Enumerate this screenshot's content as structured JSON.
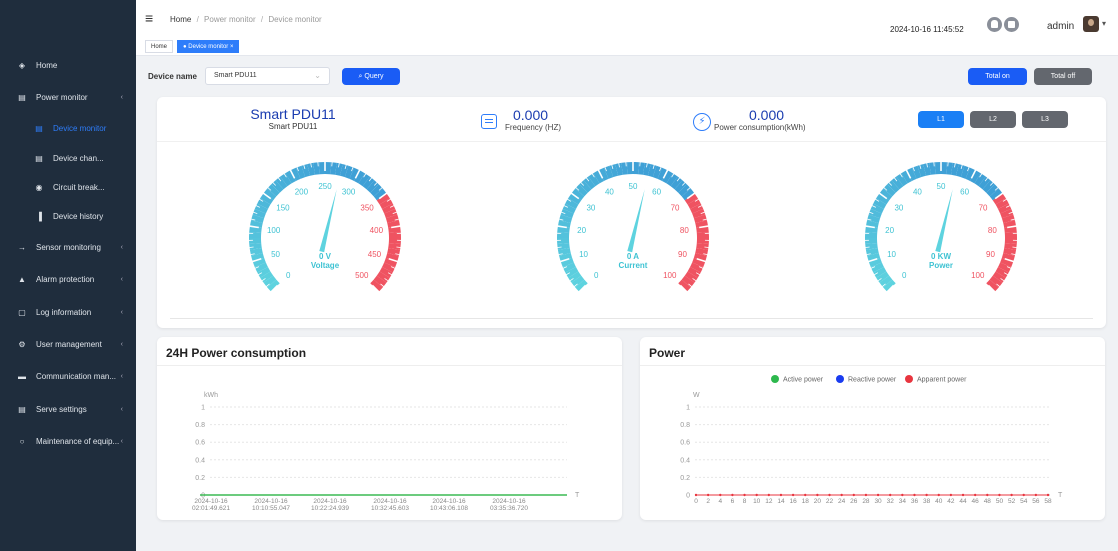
{
  "sidebar": {
    "items": [
      {
        "label": "Home",
        "icon": "dashboard-icon",
        "glyph": "◈",
        "sub": false,
        "active": false,
        "arrow": false
      },
      {
        "label": "Power monitor",
        "icon": "monitor-icon",
        "glyph": "▤",
        "sub": false,
        "active": false,
        "arrow": true
      },
      {
        "label": "Device monitor",
        "icon": "device-monitor-icon",
        "glyph": "▤",
        "sub": true,
        "active": true,
        "arrow": false
      },
      {
        "label": "Device chan...",
        "icon": "device-channel-icon",
        "glyph": "▤",
        "sub": true,
        "active": false,
        "arrow": false
      },
      {
        "label": "Circuit break...",
        "icon": "circuit-breaker-icon",
        "glyph": "◉",
        "sub": true,
        "active": false,
        "arrow": false
      },
      {
        "label": "Device history",
        "icon": "bar-chart-icon",
        "glyph": "▐",
        "sub": true,
        "active": false,
        "arrow": false
      },
      {
        "label": "Sensor monitoring",
        "icon": "sensor-icon",
        "glyph": "→",
        "sub": false,
        "active": false,
        "arrow": true
      },
      {
        "label": "Alarm protection",
        "icon": "alarm-icon",
        "glyph": "▲",
        "sub": false,
        "active": false,
        "arrow": true
      },
      {
        "label": "Log information",
        "icon": "log-icon",
        "glyph": "▢",
        "sub": false,
        "active": false,
        "arrow": true
      },
      {
        "label": "User management",
        "icon": "user-gear-icon",
        "glyph": "⚙",
        "sub": false,
        "active": false,
        "arrow": true
      },
      {
        "label": "Communication man...",
        "icon": "communication-icon",
        "glyph": "▬",
        "sub": false,
        "active": false,
        "arrow": true
      },
      {
        "label": "Serve settings",
        "icon": "server-settings-icon",
        "glyph": "▤",
        "sub": false,
        "active": false,
        "arrow": true
      },
      {
        "label": "Maintenance of equip...",
        "icon": "maintenance-icon",
        "glyph": "○",
        "sub": false,
        "active": false,
        "arrow": true
      }
    ],
    "arrow_glyph": "‹"
  },
  "header": {
    "menu_glyph": "≡",
    "breadcrumb": {
      "home": "Home",
      "sep": "/",
      "section": "Power monitor",
      "page": "Device monitor"
    },
    "datetime": "2024-10-16 11:45:52",
    "user": "admin",
    "caret": "▾"
  },
  "tags": {
    "home": "Home",
    "active": "● Device monitor ×"
  },
  "toolbar": {
    "device_label": "Device name",
    "device_value": "Smart PDU11",
    "select_arrow": "⌵",
    "query_label": "⌕ Query",
    "total_on": "Total on",
    "total_off": "Total off"
  },
  "summary": {
    "device_title": "Smart PDU11",
    "device_subtitle": "Smart PDU11",
    "frequency_value": "0.000",
    "frequency_label": "Frequency (HZ)",
    "power_value": "0.000",
    "power_label": "Power consumption(kWh)",
    "power_glyph": "⚡",
    "phases": [
      "L1",
      "L2",
      "L3"
    ],
    "active_phase": "L1"
  },
  "gauges": [
    {
      "value": 0,
      "min": 0,
      "max": 500,
      "ticks": [
        "0",
        "50",
        "100",
        "150",
        "200",
        "250",
        "300",
        "350",
        "400",
        "450",
        "500"
      ],
      "readout": "0 V",
      "name": "Voltage"
    },
    {
      "value": 0,
      "min": 0,
      "max": 100,
      "ticks": [
        "0",
        "10",
        "20",
        "30",
        "40",
        "50",
        "60",
        "70",
        "80",
        "90",
        "100"
      ],
      "readout": "0 A",
      "name": "Current"
    },
    {
      "value": 0,
      "min": 0,
      "max": 100,
      "ticks": [
        "0",
        "10",
        "20",
        "30",
        "40",
        "50",
        "60",
        "70",
        "80",
        "90",
        "100"
      ],
      "readout": "0 KW",
      "name": "Power"
    }
  ],
  "colors": {
    "accent": "#2e7dfa",
    "gauge_low": "#5ed3df",
    "gauge_mid": "#3fa0d6",
    "gauge_high": "#ef5361",
    "gauge_text": "#3fc3d3"
  },
  "chart_24h": {
    "title": "24H Power consumption"
  },
  "chart_power": {
    "title": "Power"
  },
  "chart_data": [
    {
      "type": "line",
      "title": "24H Power consumption",
      "ylabel": "kWh",
      "xlabel": "T",
      "yticks": [
        "1",
        "0.8",
        "0.6",
        "0.4",
        "0.2",
        "0"
      ],
      "ylim": [
        0,
        1
      ],
      "categories": [
        [
          "2024-10-16",
          "02:01:49.621"
        ],
        [
          "2024-10-16",
          "10:10:55.047"
        ],
        [
          "2024-10-16",
          "10:22:24.939"
        ],
        [
          "2024-10-16",
          "10:32:45.603"
        ],
        [
          "2024-10-16",
          "10:43:06.108"
        ],
        [
          "2024-10-16",
          "03:35:36.720"
        ]
      ],
      "series": [
        {
          "values": [
            0,
            0,
            0,
            0,
            0,
            0
          ],
          "color": "#3cba54"
        }
      ],
      "grid": true
    },
    {
      "type": "line",
      "title": "Power",
      "ylabel": "W",
      "xlabel": "T",
      "yticks": [
        "1",
        "0.8",
        "0.6",
        "0.4",
        "0.2",
        "0"
      ],
      "ylim": [
        0,
        1
      ],
      "x": [
        "0",
        "2",
        "4",
        "6",
        "8",
        "10",
        "12",
        "14",
        "16",
        "18",
        "20",
        "22",
        "24",
        "26",
        "28",
        "30",
        "32",
        "34",
        "36",
        "38",
        "40",
        "42",
        "44",
        "46",
        "48",
        "50",
        "52",
        "54",
        "56",
        "58"
      ],
      "series": [
        {
          "name": "Active power",
          "color": "#2db84d",
          "value": 0
        },
        {
          "name": "Reactive power",
          "color": "#1a3cf0",
          "value": 0
        },
        {
          "name": "Apparent power",
          "color": "#e8353f",
          "value": 0
        }
      ],
      "legend": "top-center",
      "grid": true
    }
  ]
}
